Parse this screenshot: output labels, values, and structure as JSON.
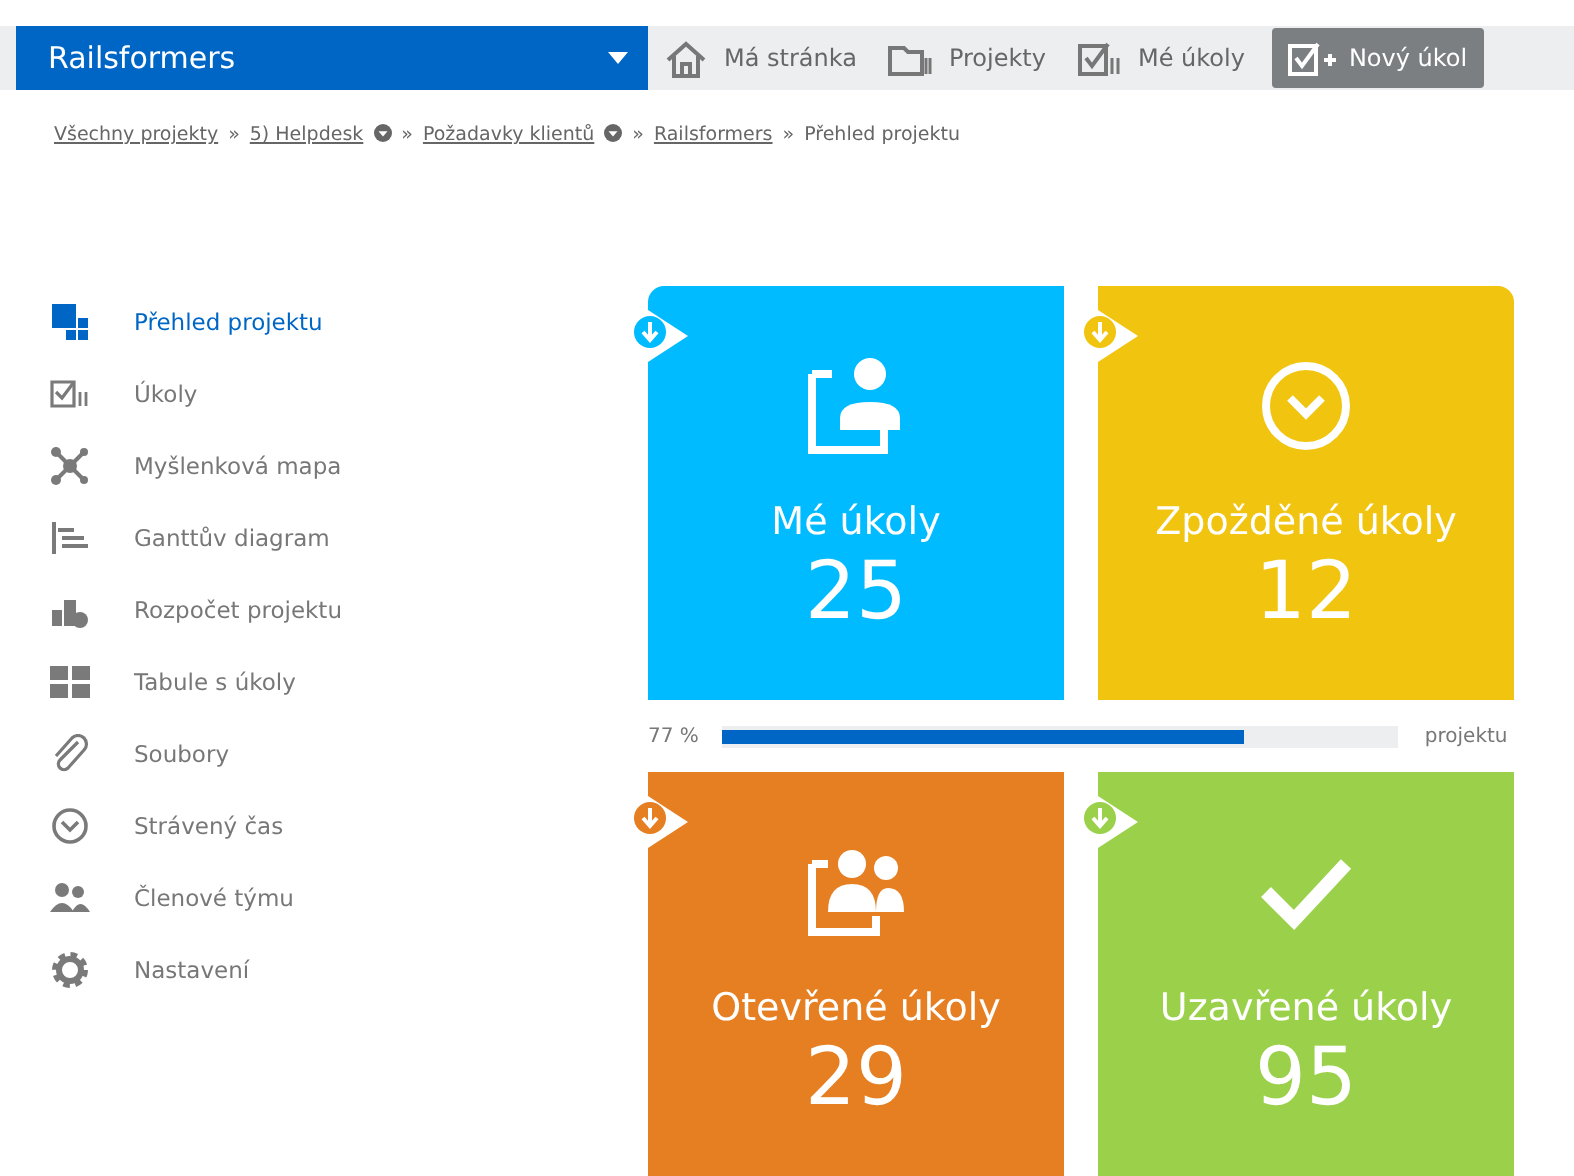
{
  "brand": {
    "title": "Railsformers"
  },
  "top_nav": [
    {
      "kind": "home",
      "label": "Má stránka",
      "selected": false
    },
    {
      "kind": "folder",
      "label": "Projekty",
      "selected": false
    },
    {
      "kind": "tasks",
      "label": "Mé úkoly",
      "selected": false
    },
    {
      "kind": "new",
      "label": "Nový úkol",
      "selected": true
    }
  ],
  "breadcrumbs": [
    {
      "label": "Všechny projekty",
      "link": true,
      "menu": false
    },
    {
      "label": "5) Helpdesk",
      "link": true,
      "menu": true
    },
    {
      "label": "Požadavky klientů",
      "link": true,
      "menu": true
    },
    {
      "label": "Railsformers",
      "link": true,
      "menu": false
    },
    {
      "label": "Přehled projektu",
      "link": false,
      "menu": false
    }
  ],
  "breadcrumb_separator": "»",
  "sidebar": {
    "items": [
      {
        "kind": "overview",
        "label": "Přehled projektu",
        "selected": true
      },
      {
        "kind": "tasks",
        "label": "Úkoly",
        "selected": false
      },
      {
        "kind": "mindmap",
        "label": "Myšlenková mapa",
        "selected": false
      },
      {
        "kind": "gantt",
        "label": "Ganttův diagram",
        "selected": false
      },
      {
        "kind": "budget",
        "label": "Rozpočet projektu",
        "selected": false
      },
      {
        "kind": "board",
        "label": "Tabule s úkoly",
        "selected": false
      },
      {
        "kind": "files",
        "label": "Soubory",
        "selected": false
      },
      {
        "kind": "time",
        "label": "Strávený čas",
        "selected": false
      },
      {
        "kind": "team",
        "label": "Členové týmu",
        "selected": false
      },
      {
        "kind": "settings",
        "label": "Nastavení",
        "selected": false
      }
    ]
  },
  "tiles_top": [
    {
      "kind": "person",
      "label": "Mé úkoly",
      "count": "25",
      "color": "#00bbff"
    },
    {
      "kind": "clock",
      "label": "Zpožděné úkoly",
      "count": "12",
      "color": "#f1c40f"
    }
  ],
  "progress": {
    "reading": "77 %",
    "level": 0.77,
    "label": "projektu"
  },
  "tiles_bottom": [
    {
      "kind": "people",
      "label": "Otevřené úkoly",
      "count": "29",
      "color": "#e67e22"
    },
    {
      "kind": "check",
      "label": "Uzavřené úkoly",
      "count": "95",
      "color": "#9bd14a"
    }
  ]
}
